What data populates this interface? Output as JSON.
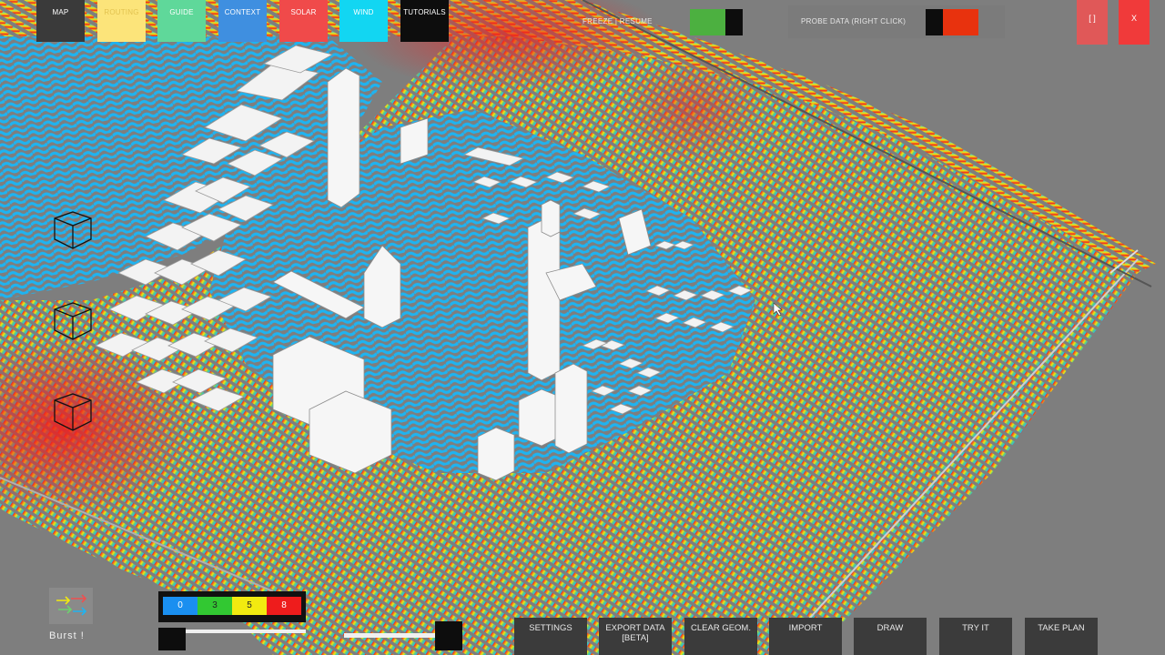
{
  "top_nav": [
    {
      "label": "MAP",
      "bg": "#3a3a3a",
      "fg": "#ffffff"
    },
    {
      "label": "ROUTING",
      "bg": "#fce47a",
      "fg": "#e2c350"
    },
    {
      "label": "GUIDE",
      "bg": "#5fd89a",
      "fg": "#ffffff"
    },
    {
      "label": "CONTEXT",
      "bg": "#3f8fe0",
      "fg": "#ffffff"
    },
    {
      "label": "SOLAR",
      "bg": "#f04a4a",
      "fg": "#ffffff"
    },
    {
      "label": "WIND",
      "bg": "#12d6f2",
      "fg": "#ffffff"
    },
    {
      "label": "TUTORIALS",
      "bg": "#0d0d0d",
      "fg": "#ffffff"
    }
  ],
  "freeze_label": "FREEZE | RESUME",
  "probe_label": "PROBE DATA (RIGHT CLICK)",
  "window_buttons": {
    "restore": "[ ]",
    "close": "X"
  },
  "burst_label": "Burst !",
  "legend": [
    {
      "value": "0",
      "color": "#1a8ff0",
      "fg": "#ffffff"
    },
    {
      "value": "3",
      "color": "#32c832",
      "fg": "#222222"
    },
    {
      "value": "5",
      "color": "#f2ea10",
      "fg": "#222222"
    },
    {
      "value": "8",
      "color": "#ee1c1c",
      "fg": "#ffffff"
    }
  ],
  "bottom_buttons": [
    {
      "label": "SETTINGS",
      "name": "settings-button"
    },
    {
      "label": "EXPORT DATA\n[BETA]",
      "name": "export-data-button"
    },
    {
      "label": "CLEAR GEOM.",
      "name": "clear-geometry-button"
    },
    {
      "label": "IMPORT",
      "name": "import-button"
    },
    {
      "label": "DRAW",
      "name": "draw-button"
    },
    {
      "label": "TRY IT",
      "name": "try-it-button"
    },
    {
      "label": "TAKE PLAN",
      "name": "take-plan-button"
    }
  ],
  "colors": {
    "wind_low": "#1fb3f0",
    "wind_mid": "#66d07a",
    "wind_high": "#f2ea10",
    "wind_peak": "#ee2020",
    "ground": "#7e7e7e"
  }
}
